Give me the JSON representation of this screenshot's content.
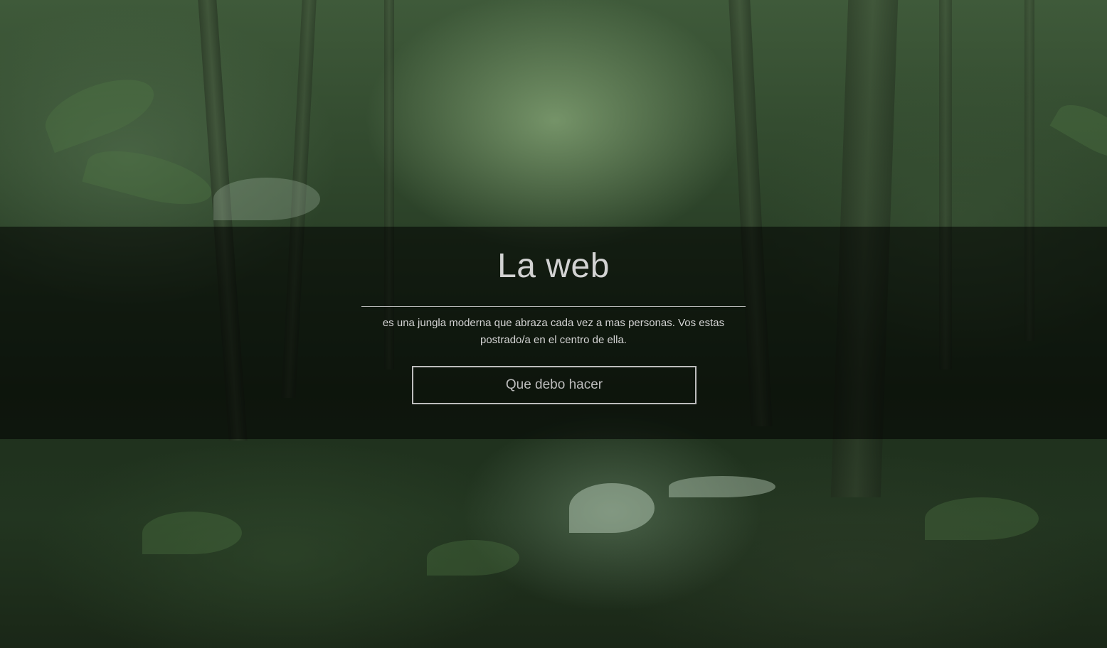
{
  "hero": {
    "title": "La web",
    "description": "es una jungla moderna que abraza cada vez a mas personas. Vos estas postrado/a en el centro de ella.",
    "cta_label": "Que debo hacer"
  },
  "background": {
    "image": "jungle-forest-photo"
  }
}
